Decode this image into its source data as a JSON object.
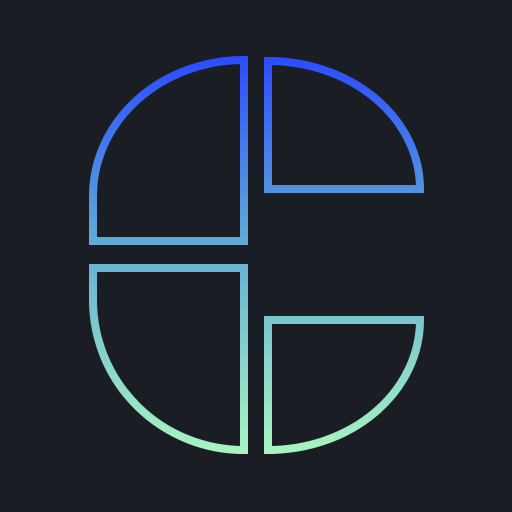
{
  "icon": {
    "name": "quadrant-logo-icon",
    "colors": {
      "background": "#1b1d25",
      "gradient_top": "#2a4bff",
      "gradient_mid": "#5fa8d6",
      "gradient_bottom": "#a9f5c0"
    }
  }
}
